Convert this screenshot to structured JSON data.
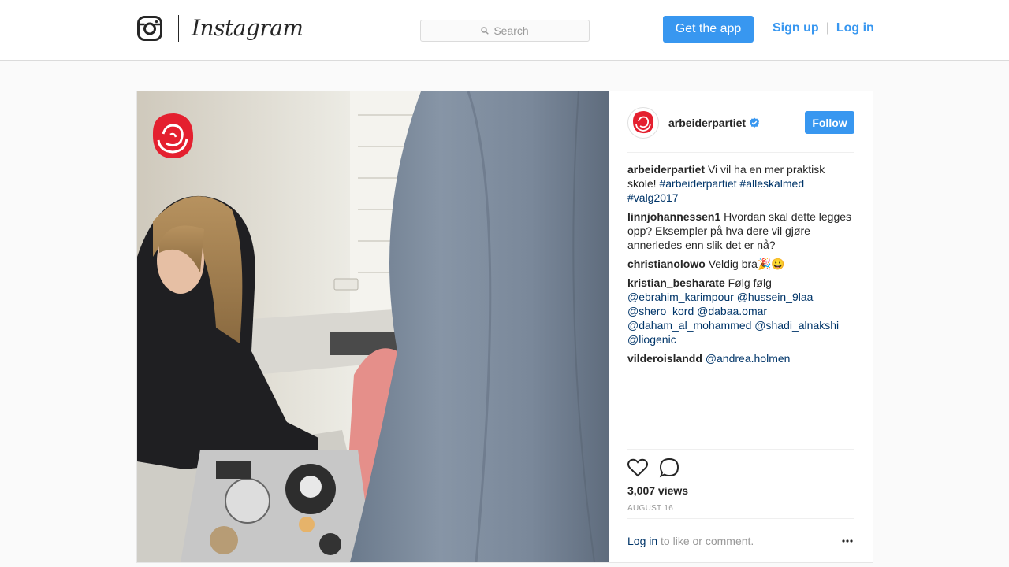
{
  "header": {
    "brand": "Instagram",
    "search_placeholder": "Search",
    "get_app_label": "Get the app",
    "signup_label": "Sign up",
    "login_label": "Log in",
    "separator": "|"
  },
  "post": {
    "username": "arbeiderpartiet",
    "follow_label": "Follow",
    "comments": [
      {
        "user": "arbeiderpartiet",
        "text": "Vi vil ha en mer praktisk skole!",
        "tags": "#arbeiderpartiet #alleskalmed #valg2017"
      },
      {
        "user": "linnjohannessen1",
        "text": "Hvordan skal dette legges opp? Eksempler på hva dere vil gjøre annerledes enn slik det er nå?",
        "tags": ""
      },
      {
        "user": "christianolowo",
        "text": "Veldig bra🎉😀",
        "tags": ""
      },
      {
        "user": "kristian_besharate",
        "text": "Følg følg",
        "tags": "@ebrahim_karimpour @hussein_9laa @shero_kord @dabaa.omar @daham_al_mohammed @shadi_alnakshi @liogenic"
      },
      {
        "user": "vilderoislandd",
        "text": "",
        "tags": "@andrea.holmen"
      }
    ],
    "views": "3,007 views",
    "date": "AUGUST 16",
    "login_link": "Log in",
    "login_suffix": "to like or comment.",
    "more_icon": "more-horizontal-icon",
    "icons": [
      "heart-icon",
      "comment-icon"
    ]
  },
  "colors": {
    "accent": "#3897f0",
    "link": "#003569",
    "rose_red": "#e4202f"
  }
}
